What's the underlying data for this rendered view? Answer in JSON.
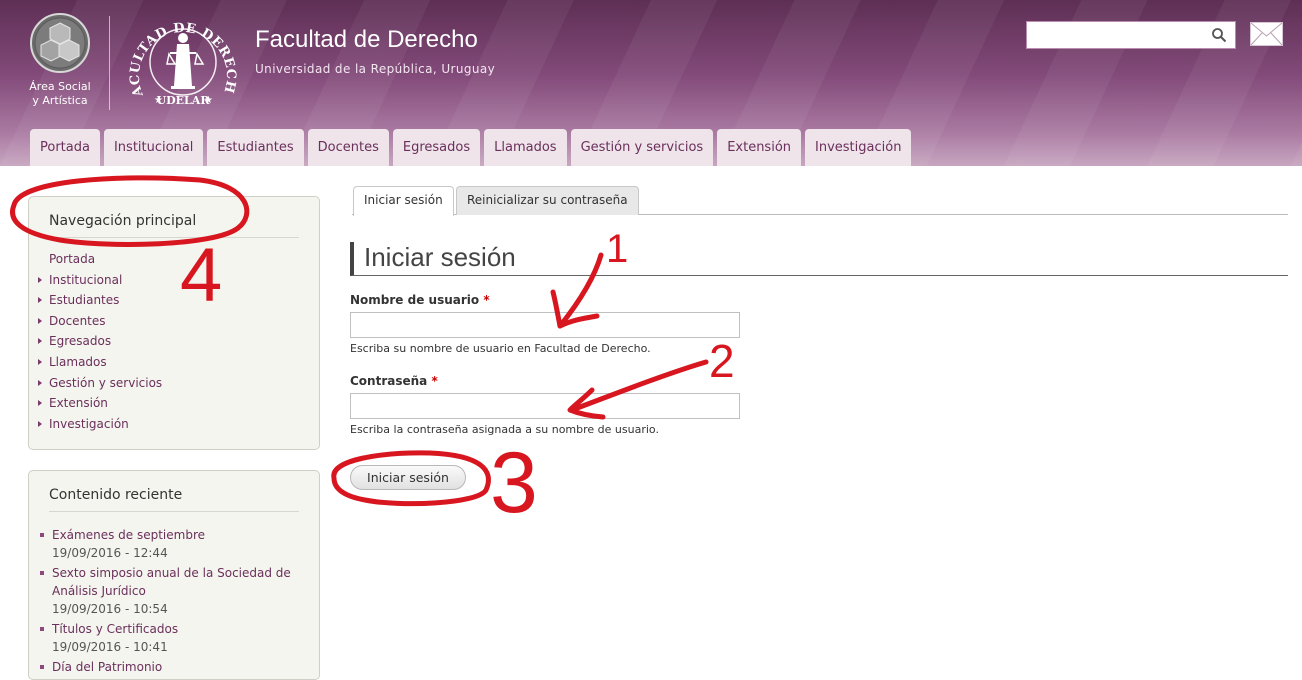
{
  "header": {
    "area_text_line1": "Área Social",
    "area_text_line2": "y Artística",
    "logo_arc_text": "FACULTAD DE DERECHO",
    "logo_bottom_text": "UDELAR",
    "site_name": "Facultad de Derecho",
    "site_slogan": "Universidad de la República, Uruguay",
    "search": {
      "value": "",
      "placeholder": ""
    },
    "icons": {
      "search": "search-icon",
      "mail": "mail-icon",
      "area_logo": "area-logo-icon"
    }
  },
  "nav": {
    "items": [
      {
        "label": "Portada"
      },
      {
        "label": "Institucional"
      },
      {
        "label": "Estudiantes"
      },
      {
        "label": "Docentes"
      },
      {
        "label": "Egresados"
      },
      {
        "label": "Llamados"
      },
      {
        "label": "Gestión y servicios"
      },
      {
        "label": "Extensión"
      },
      {
        "label": "Investigación"
      }
    ]
  },
  "sidebar": {
    "nav_block": {
      "title": "Navegación principal",
      "items": [
        {
          "label": "Portada"
        },
        {
          "label": "Institucional"
        },
        {
          "label": "Estudiantes"
        },
        {
          "label": "Docentes"
        },
        {
          "label": "Egresados"
        },
        {
          "label": "Llamados"
        },
        {
          "label": "Gestión y servicios"
        },
        {
          "label": "Extensión"
        },
        {
          "label": "Investigación"
        }
      ]
    },
    "recent_block": {
      "title": "Contenido reciente",
      "items": [
        {
          "title": "Exámenes de septiembre",
          "date": "19/09/2016 - 12:44"
        },
        {
          "title": "Sexto simposio anual de la Sociedad de Análisis Jurídico",
          "date": "19/09/2016 - 10:54"
        },
        {
          "title": "Títulos y Certificados",
          "date": "19/09/2016 - 10:41"
        },
        {
          "title": "Día del Patrimonio",
          "date": ""
        }
      ]
    }
  },
  "main": {
    "tabs": [
      {
        "label": "Iniciar sesión",
        "active": true
      },
      {
        "label": "Reinicializar su contraseña",
        "active": false
      }
    ],
    "page_title": "Iniciar sesión",
    "form": {
      "username": {
        "label": "Nombre de usuario",
        "required_mark": "*",
        "value": "",
        "description": "Escriba su nombre de usuario en Facultad de Derecho."
      },
      "password": {
        "label": "Contraseña",
        "required_mark": "*",
        "value": "",
        "description": "Escriba la contraseña asignada a su nombre de usuario."
      },
      "submit_label": "Iniciar sesión"
    }
  },
  "annotations": {
    "color": "#d8161f",
    "labels": [
      "1",
      "2",
      "3",
      "4"
    ]
  }
}
